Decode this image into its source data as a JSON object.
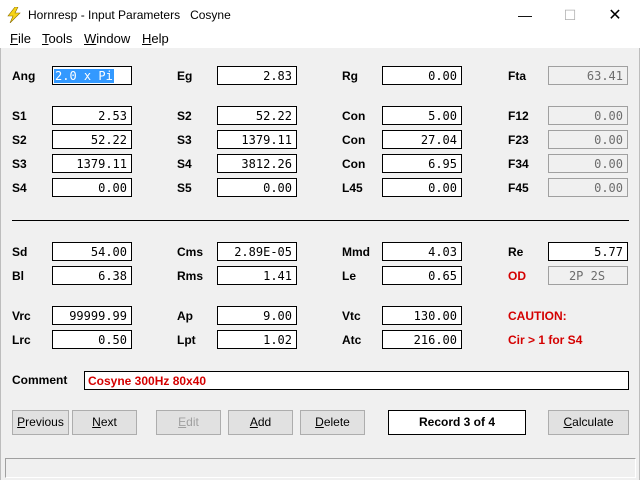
{
  "window": {
    "title": "Hornresp - Input Parameters   Cosyne",
    "minimize_glyph": "—",
    "maximize_glyph": "☐",
    "close_glyph": "✕"
  },
  "menu": {
    "file": {
      "first": "F",
      "rest": "ile"
    },
    "tools": {
      "first": "T",
      "rest": "ools"
    },
    "window": {
      "first": "W",
      "rest": "indow"
    },
    "help": {
      "first": "H",
      "rest": "elp"
    }
  },
  "params": {
    "ang": {
      "label": "Ang",
      "value": "2.0 x Pi"
    },
    "eg": {
      "label": "Eg",
      "value": "2.83"
    },
    "rg": {
      "label": "Rg",
      "value": "0.00"
    },
    "fta": {
      "label": "Fta",
      "value": "63.41"
    },
    "s1a": {
      "label": "S1",
      "value": "2.53"
    },
    "s2a": {
      "label": "S2",
      "value": "52.22"
    },
    "con1": {
      "label": "Con",
      "value": "5.00"
    },
    "f12": {
      "label": "F12",
      "value": "0.00"
    },
    "s2b": {
      "label": "S2",
      "value": "52.22"
    },
    "s3a": {
      "label": "S3",
      "value": "1379.11"
    },
    "con2": {
      "label": "Con",
      "value": "27.04"
    },
    "f23": {
      "label": "F23",
      "value": "0.00"
    },
    "s3b": {
      "label": "S3",
      "value": "1379.11"
    },
    "s4a": {
      "label": "S4",
      "value": "3812.26"
    },
    "con3": {
      "label": "Con",
      "value": "6.95"
    },
    "f34": {
      "label": "F34",
      "value": "0.00"
    },
    "s4b": {
      "label": "S4",
      "value": "0.00"
    },
    "s5": {
      "label": "S5",
      "value": "0.00"
    },
    "l45": {
      "label": "L45",
      "value": "0.00"
    },
    "f45": {
      "label": "F45",
      "value": "0.00"
    },
    "sd": {
      "label": "Sd",
      "value": "54.00"
    },
    "cms": {
      "label": "Cms",
      "value": "2.89E-05"
    },
    "mmd": {
      "label": "Mmd",
      "value": "4.03"
    },
    "re": {
      "label": "Re",
      "value": "5.77"
    },
    "bl": {
      "label": "Bl",
      "value": "6.38"
    },
    "rms": {
      "label": "Rms",
      "value": "1.41"
    },
    "le": {
      "label": "Le",
      "value": "0.65"
    },
    "od": {
      "label": "OD",
      "value": "2P 2S"
    },
    "vrc": {
      "label": "Vrc",
      "value": "99999.99"
    },
    "ap": {
      "label": "Ap",
      "value": "9.00"
    },
    "vtc": {
      "label": "Vtc",
      "value": "130.00"
    },
    "lrc": {
      "label": "Lrc",
      "value": "0.50"
    },
    "lpt": {
      "label": "Lpt",
      "value": "1.02"
    },
    "atc": {
      "label": "Atc",
      "value": "216.00"
    }
  },
  "caution": {
    "title": "CAUTION:",
    "message": "Cir > 1 for S4"
  },
  "comment": {
    "label": "Comment",
    "value": "Cosyne 300Hz 80x40"
  },
  "buttons": {
    "previous": {
      "first": "P",
      "rest": "revious"
    },
    "next": {
      "first": "N",
      "rest": "ext"
    },
    "edit": {
      "first": "E",
      "rest": "dit"
    },
    "add": {
      "first": "A",
      "rest": "dd"
    },
    "delete": {
      "first": "D",
      "rest": "elete"
    },
    "calculate": {
      "first": "C",
      "rest": "alculate"
    }
  },
  "record": "Record 3 of 4",
  "colors": {
    "caution_red": "#d40000",
    "selection_blue": "#3399ff"
  },
  "icons": {
    "app": "lightning-bolt-icon"
  }
}
